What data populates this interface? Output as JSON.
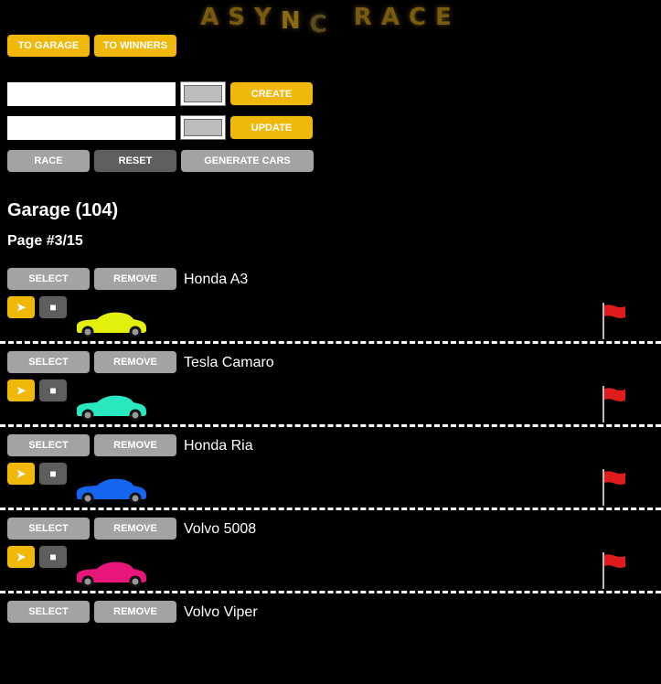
{
  "app": {
    "logo_parts": [
      "AS",
      "Y",
      "N",
      "C",
      "R",
      "ACE"
    ]
  },
  "nav": {
    "garage_label": "TO GARAGE",
    "winners_label": "TO WINNERS"
  },
  "create": {
    "name_value": "",
    "color": "#bdbdbd",
    "button_label": "CREATE"
  },
  "update": {
    "name_value": "",
    "color": "#bdbdbd",
    "button_label": "UPDATE"
  },
  "controls": {
    "race_label": "RACE",
    "reset_label": "RESET",
    "generate_label": "GENERATE CARS"
  },
  "garage": {
    "title": "Garage (104)",
    "page": "Page #3/15"
  },
  "cars": [
    {
      "name": "Honda A3",
      "color": "#e3f00b"
    },
    {
      "name": "Tesla Camaro",
      "color": "#29e8c0"
    },
    {
      "name": "Honda Ria",
      "color": "#1565f0"
    },
    {
      "name": "Volvo 5008",
      "color": "#e8157a"
    },
    {
      "name": "Volvo Viper",
      "color": ""
    }
  ],
  "car_actions": {
    "select_label": "SELECT",
    "remove_label": "REMOVE",
    "start_glyph": "➤",
    "stop_glyph": "■",
    "start_icon": "play-icon",
    "stop_icon": "stop-icon"
  },
  "colors": {
    "accent": "#f0b80a",
    "button_grey": "#a3a3a3",
    "button_dark": "#5e5e5e",
    "flag": "#e01b1b"
  }
}
